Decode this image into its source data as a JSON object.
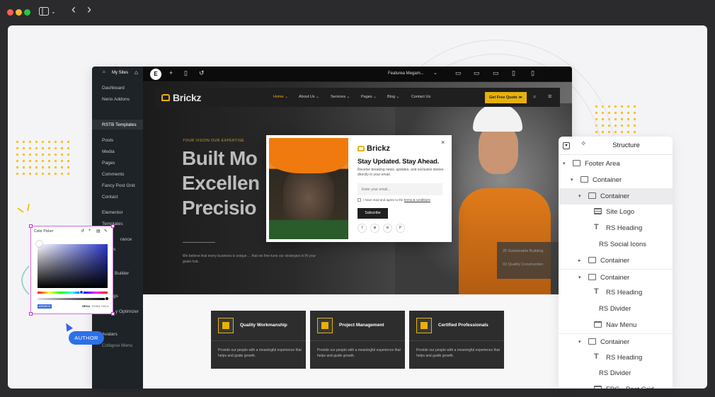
{
  "window": {
    "sidebar_toggle_icon": "sidebar-icon",
    "back_icon": "‹",
    "forward_icon": "›"
  },
  "wp": {
    "site_label": "My Sites",
    "menu": [
      {
        "label": "Dashboard",
        "active": false
      },
      {
        "label": "Nerio Addons",
        "active": false
      },
      {
        "label": "RSTB Templates",
        "active": true
      },
      {
        "label": "Posts",
        "active": false
      },
      {
        "label": "Media",
        "active": false
      },
      {
        "label": "Pages",
        "active": false
      },
      {
        "label": "Comments",
        "active": false
      },
      {
        "label": "Fancy Post Grid",
        "active": false
      },
      {
        "label": "Contact",
        "active": false
      },
      {
        "label": "Elementor",
        "active": false
      },
      {
        "label": "Templates",
        "active": false
      },
      {
        "label": "rance",
        "active": false
      },
      {
        "label": "s",
        "active": false
      },
      {
        "label": "Builder",
        "active": false
      },
      {
        "label": "gs",
        "active": false
      },
      {
        "label": "y Optimizer",
        "active": false
      },
      {
        "label": "Avatars",
        "active": false
      },
      {
        "label": "Collapse Menu",
        "active": false
      }
    ]
  },
  "editor_toolbar": {
    "page_select": "Featurea Megam...",
    "devices": [
      "desktop",
      "laptop",
      "tablet-landscape",
      "tablet",
      "mobile"
    ]
  },
  "site": {
    "brand": "Brickz",
    "nav": [
      "Home ⌄",
      "About Us ⌄",
      "Services ⌄",
      "Pages ⌄",
      "Blog ⌄",
      "Contact Us"
    ],
    "cta": "Get Free Quote ≫",
    "eyebrow": "YOUR VISION OUR EXPERTISE",
    "headline": [
      "Built Mo",
      "Excellen",
      "Precisio"
    ],
    "paragraph": "We believe that every business is unique ... that we fine-tune our strategies to fit your goals hub.",
    "stats": [
      "25 Sustainable Building",
      "02 Quality Construction"
    ],
    "cards": [
      {
        "title": "Quality Workmanship",
        "text": "Provide our people with a meaningful experience that helps and guide growth."
      },
      {
        "title": "Project Management",
        "text": "Provide our people with a meaningful experience that helps and guide growth."
      },
      {
        "title": "Certified Professionals",
        "text": "Provide our people with a meaningful experience that helps and guide growth."
      }
    ]
  },
  "popup": {
    "brand": "Brickz",
    "close": "×",
    "title": "Stay Updated. Stay Ahead.",
    "description": "Receive breaking news, updates, and exclusive stories directly in your email.",
    "email_placeholder": "Enter your email...",
    "agree_text": "I have read and agree to the",
    "agree_link": "terms & conditions",
    "subscribe": "Subscribe",
    "social": [
      "f",
      "⊗",
      "in",
      "P"
    ]
  },
  "color_picker": {
    "title": "Color Picker",
    "hex_value": "#2B39C6",
    "modes": [
      "HEXA",
      "RGBA",
      "HSLA"
    ],
    "selected_mode": "HEXA",
    "hue_fraction": 0.66,
    "alpha_fraction": 1.0
  },
  "collaborator": {
    "label": "AUTHOR"
  },
  "structure": {
    "title": "Structure",
    "items": [
      {
        "label": "Footer Area",
        "depth": 0,
        "icon": "container",
        "arrow": "▾",
        "selected": false
      },
      {
        "label": "Container",
        "depth": 1,
        "icon": "container",
        "arrow": "▾",
        "selected": false
      },
      {
        "label": "Container",
        "depth": 2,
        "icon": "container",
        "arrow": "▾",
        "selected": true
      },
      {
        "label": "Site Logo",
        "depth": 3,
        "icon": "logo",
        "arrow": "",
        "selected": false
      },
      {
        "label": "RS Heading",
        "depth": 3,
        "icon": "T",
        "arrow": "",
        "selected": false
      },
      {
        "label": "RS Social Icons",
        "depth": 3,
        "icon": "none",
        "arrow": "",
        "selected": false
      },
      {
        "label": "Container",
        "depth": 2,
        "icon": "container",
        "arrow": "▸",
        "selected": false
      },
      {
        "label": "Container",
        "depth": 2,
        "icon": "container",
        "arrow": "▾",
        "selected": false
      },
      {
        "label": "RS Heading",
        "depth": 3,
        "icon": "T",
        "arrow": "",
        "selected": false
      },
      {
        "label": "RS Divider",
        "depth": 3,
        "icon": "none",
        "arrow": "",
        "selected": false
      },
      {
        "label": "Nav Menu",
        "depth": 3,
        "icon": "nav",
        "arrow": "",
        "selected": false
      },
      {
        "label": "Container",
        "depth": 2,
        "icon": "container",
        "arrow": "▾",
        "selected": false
      },
      {
        "label": "RS Heading",
        "depth": 3,
        "icon": "T",
        "arrow": "",
        "selected": false
      },
      {
        "label": "RS Divider",
        "depth": 3,
        "icon": "none",
        "arrow": "",
        "selected": false
      },
      {
        "label": "FPG - Post Grid",
        "depth": 3,
        "icon": "logo",
        "arrow": "",
        "selected": false
      }
    ]
  }
}
